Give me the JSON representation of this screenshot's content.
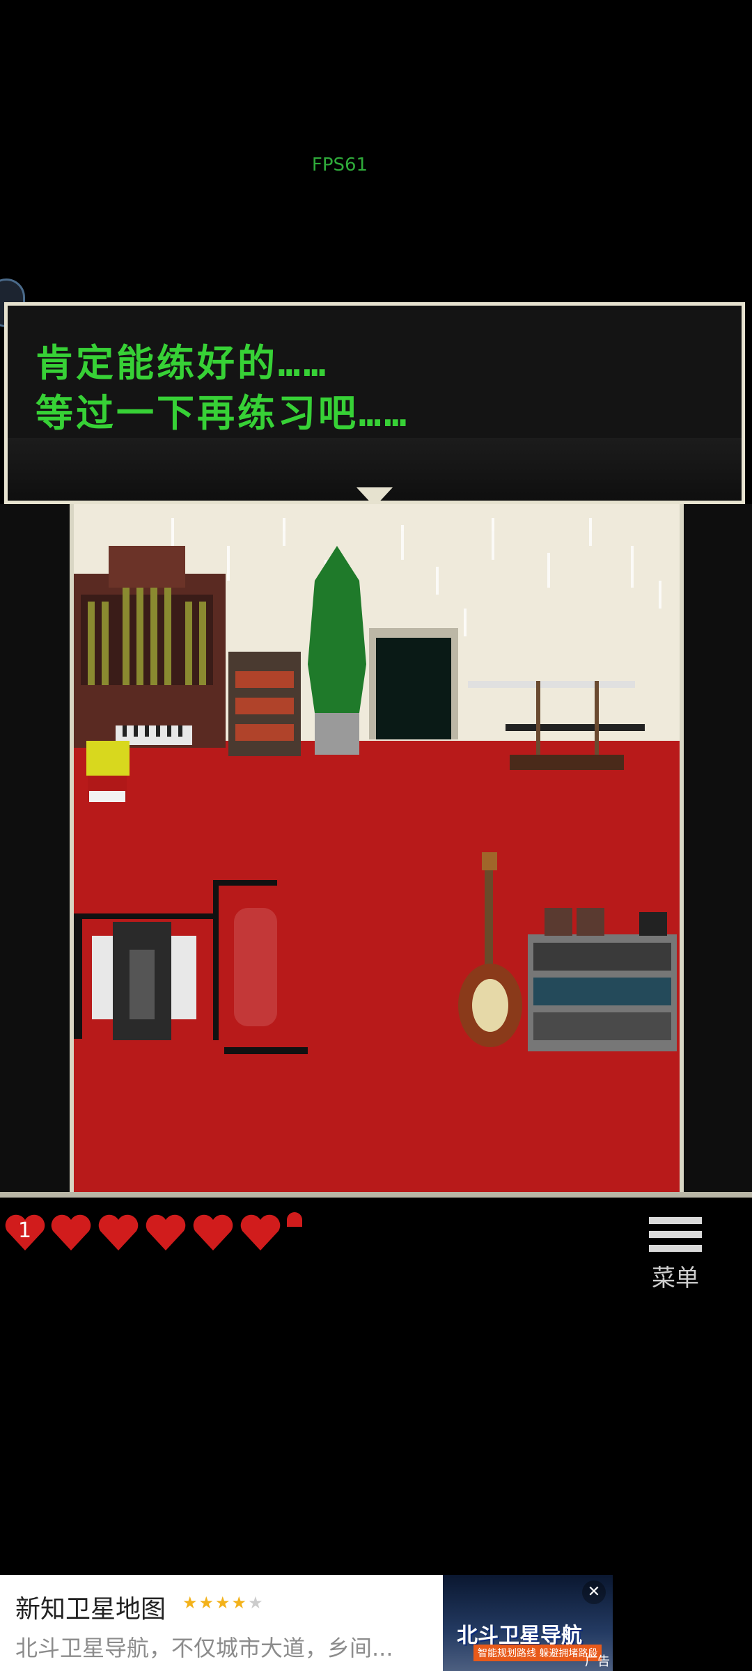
{
  "fps": "FPS61",
  "dialog": {
    "line1": "肯定能练好的……",
    "line2": "等过一下再练习吧……"
  },
  "hud": {
    "hearts": [
      {
        "label": "1"
      },
      {
        "label": ""
      },
      {
        "label": ""
      },
      {
        "label": ""
      },
      {
        "label": ""
      },
      {
        "label": ""
      }
    ],
    "partial_heart": true
  },
  "menu": {
    "label": "菜单"
  },
  "ad": {
    "title": "新知卫星地图",
    "rating_stars": 4,
    "description": "北斗卫星导航，不仅城市大道，乡间...",
    "image_text": "北斗卫星导航",
    "image_subtext": "智能规划路线 躲避拥堵路段",
    "tag": "广告",
    "close_icon": "close-icon"
  },
  "colors": {
    "dialog_text": "#37d136",
    "floor": "#b81a1a",
    "wall": "#efeadb",
    "heart": "#d11c1c"
  }
}
